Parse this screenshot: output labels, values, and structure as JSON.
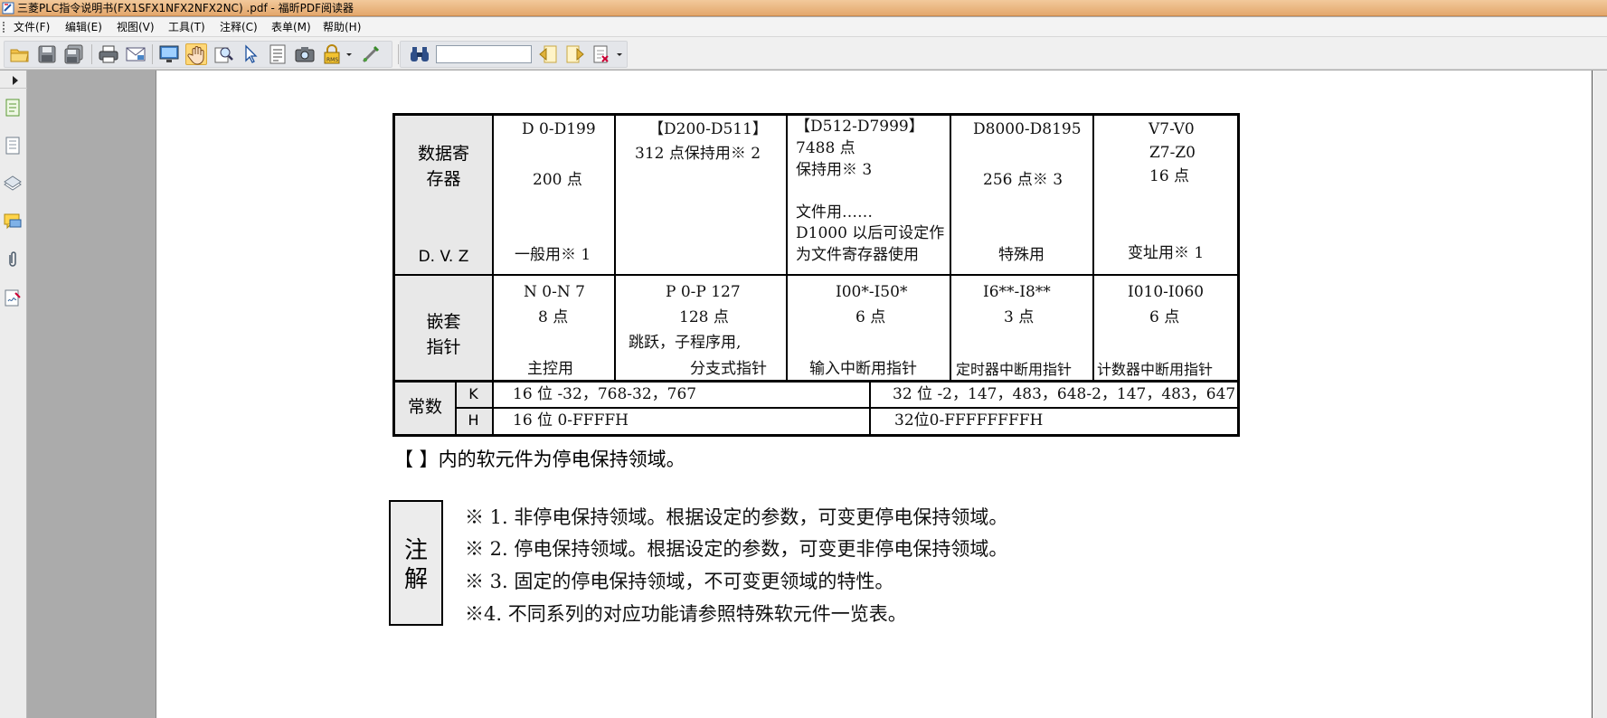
{
  "window": {
    "title": "三菱PLC指令说明书(FX1SFX1NFX2NFX2NC) .pdf - 福昕PDF阅读器"
  },
  "menu": {
    "items": [
      "文件(F)",
      "编辑(E)",
      "视图(V)",
      "工具(T)",
      "注释(C)",
      "表单(M)",
      "帮助(H)"
    ]
  },
  "toolbar": {
    "icons": [
      "open-folder-icon",
      "save-icon",
      "save-as-icon",
      "print-icon",
      "email-icon",
      "fullscreen-icon",
      "hand-tool-icon",
      "zoom-tool-icon",
      "select-arrow-icon",
      "text-select-icon",
      "snapshot-icon",
      "rms-lock-icon",
      "measure-tool-icon",
      "find-binoculars-icon",
      "search-prev-icon",
      "search-next-icon",
      "search-options-icon"
    ],
    "search_value": ""
  },
  "sidebar": {
    "icons": [
      "pages-panel-icon",
      "bookmarks-panel-icon",
      "layers-panel-icon",
      "comments-panel-icon",
      "attachments-panel-icon",
      "signature-panel-icon"
    ]
  },
  "document": {
    "table": {
      "data_register_header": [
        "数据寄",
        "存器"
      ],
      "data_register_sub": "D. V. Z",
      "data_cells": {
        "c1_line1": "D  0-D199",
        "c1_line2": "200 点",
        "c1_line3": "一般用※ 1",
        "c2_line1": "【D200-D511】",
        "c2_line2": "312 点保持用※ 2",
        "c3_line1": "【D512-D7999】",
        "c3_line2": "7488 点",
        "c3_line3": "保持用※ 3",
        "c3_line4": "文件用……",
        "c3_line5": "D1000 以后可设定作",
        "c3_line6": "为文件寄存器使用",
        "c4_line1": "D8000-D8195",
        "c4_line2": "256 点※ 3",
        "c4_line3": "特殊用",
        "c5_line1": "V7-V0",
        "c5_line2": "Z7-Z0",
        "c5_line3": "16 点",
        "c5_line4": "变址用※ 1"
      },
      "pointer_header": [
        "嵌套",
        "指针"
      ],
      "pointer_cells": {
        "c1_line1": "N  0-N  7",
        "c1_line2": "8 点",
        "c1_line3": "主控用",
        "c2_line1": "P  0-P  127",
        "c2_line2": "128 点",
        "c2_line3": "跳跃，子程序用,",
        "c2_line4": "分支式指针",
        "c3_line1": "I00*-I50*",
        "c3_line2": "6 点",
        "c3_line3": "输入中断用指针",
        "c4_line1": "I6**-I8**",
        "c4_line2": "3 点",
        "c4_line3": "定时器中断用指针",
        "c5_line1": "I010-I060",
        "c5_line2": "6 点",
        "c5_line3": "计数器中断用指针"
      },
      "constant_header": "常数",
      "constant_rows": {
        "k_label": "K",
        "k_16": "16 位 -32，768-32，767",
        "k_32": "32 位 -2，147，483，648-2，147，483，647",
        "h_label": "H",
        "h_16": "16 位 0-FFFFH",
        "h_32": "32位0-FFFFFFFFH"
      }
    },
    "bracket_note": "【   】内的软元件为停电保持领域。",
    "notes_label": [
      "注",
      "解"
    ],
    "notes": [
      "※ 1. 非停电保持领域。根据设定的参数，可变更停电保持领域。",
      "※ 2. 停电保持领域。根据设定的参数，可变更非停电保持领域。",
      "※ 3. 固定的停电保持领域，不可变更领域的特性。",
      "※4. 不同系列的对应功能请参照特殊软元件一览表。"
    ]
  }
}
